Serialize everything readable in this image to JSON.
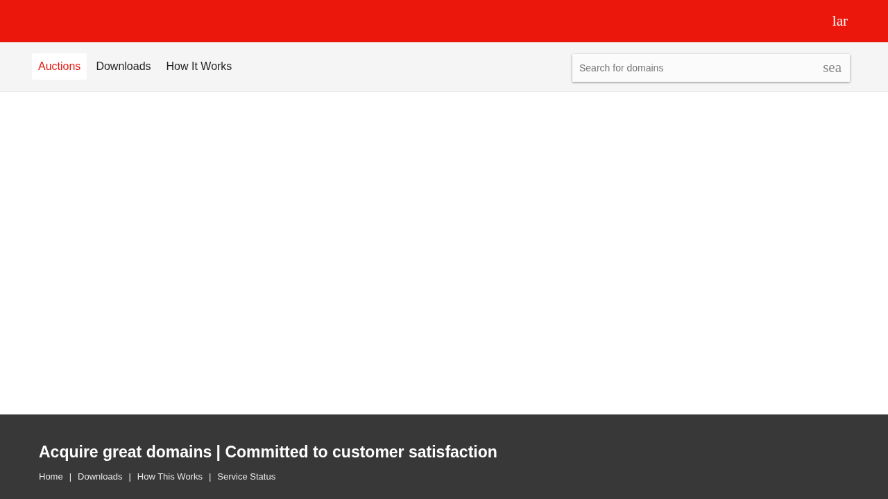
{
  "header": {
    "button_text": "lar"
  },
  "nav": {
    "tabs": [
      {
        "label": "Auctions",
        "selected": true
      },
      {
        "label": "Downloads",
        "selected": false
      },
      {
        "label": "How It Works",
        "selected": false
      }
    ]
  },
  "search": {
    "placeholder": "Search for domains",
    "button_text": "sea"
  },
  "footer": {
    "tagline": "Acquire great domains | Committed to customer satisfaction",
    "links": [
      "Home",
      "Downloads",
      "How This Works",
      "Service Status"
    ],
    "separator": "|"
  }
}
